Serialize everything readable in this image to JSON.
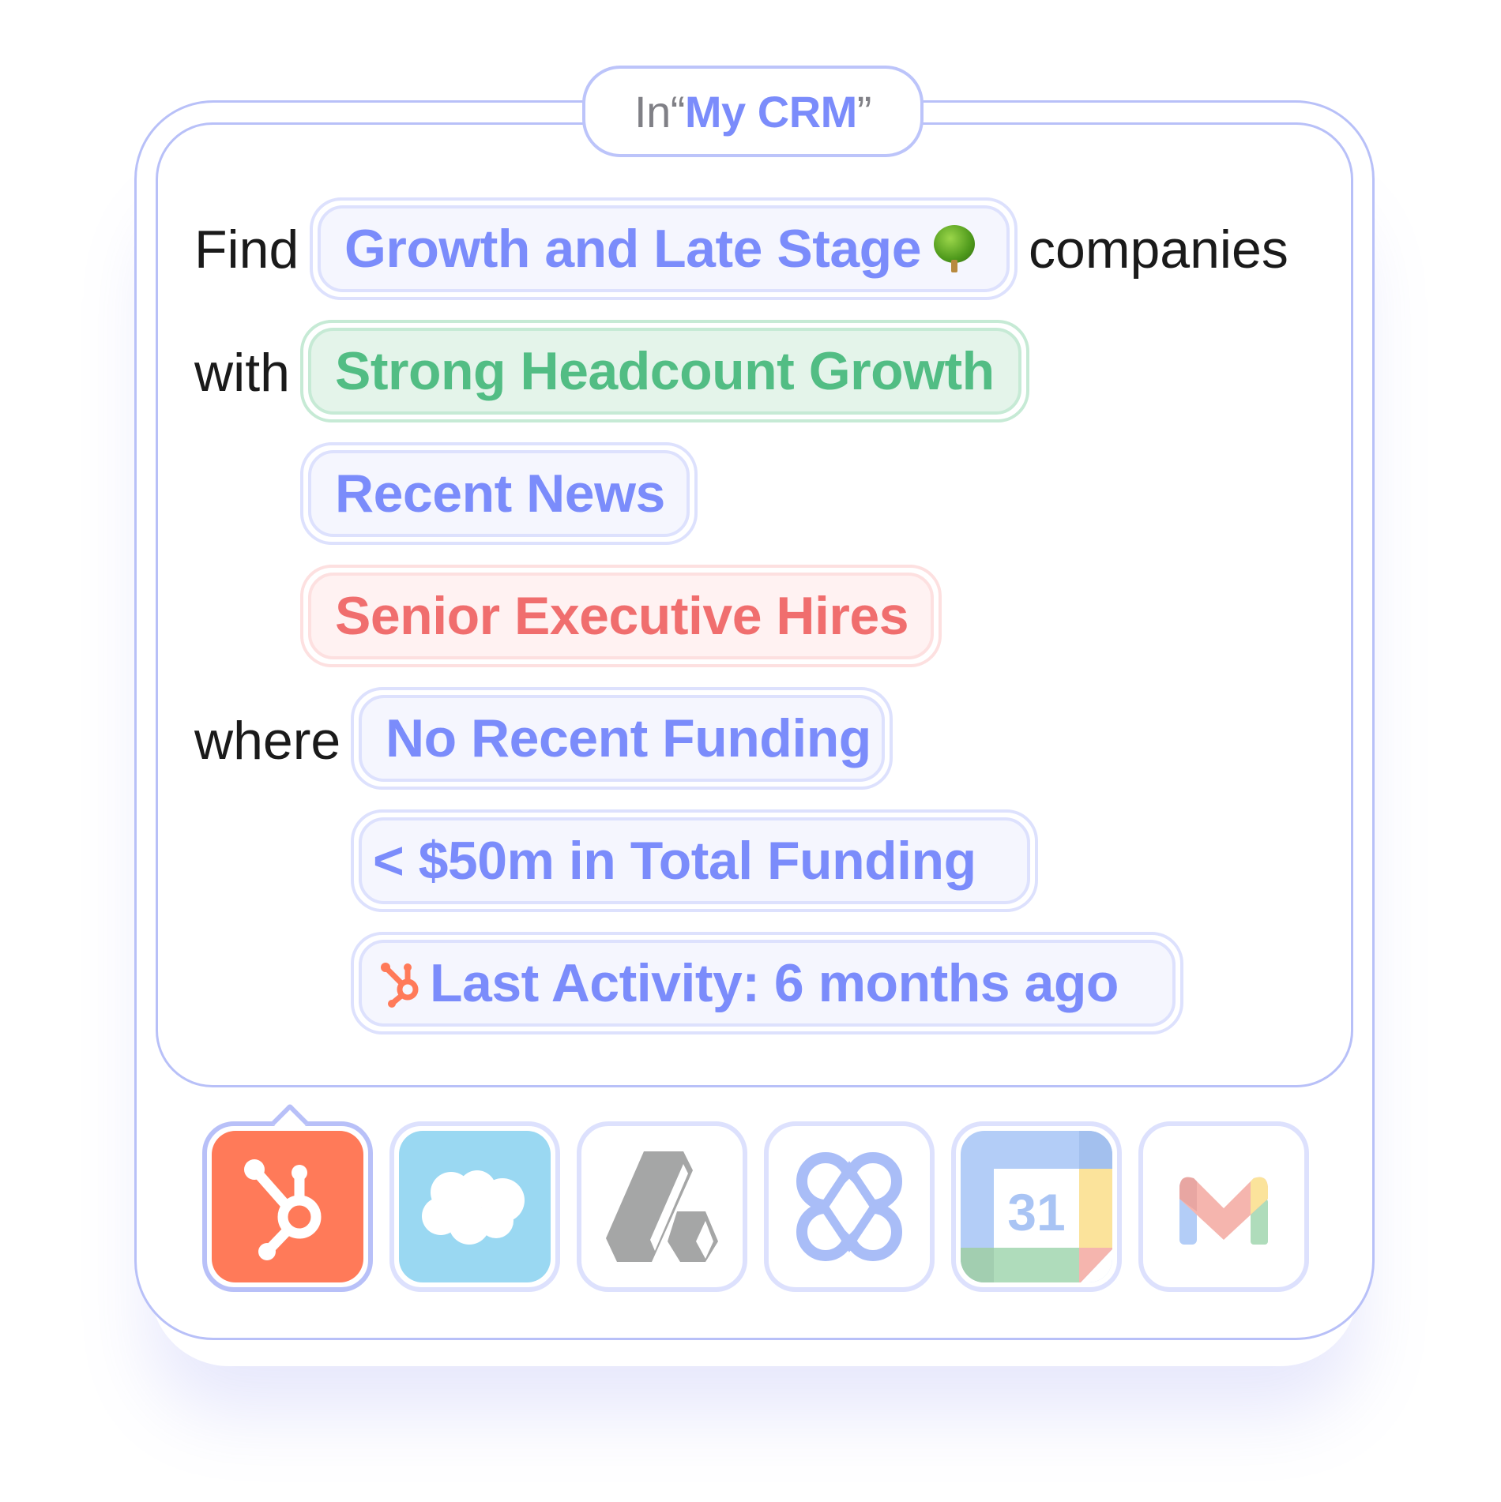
{
  "source": {
    "prefix": "In ",
    "open_quote": "“",
    "name": "My CRM",
    "close_quote": "”"
  },
  "query": {
    "find_label": "Find",
    "stage_filter": "Growth and Late Stage",
    "stage_emoji_icon": "deciduous-tree-icon",
    "companies_label": "companies",
    "with_label": "with",
    "signals": [
      {
        "label": "Strong Headcount Growth",
        "color": "#52bd84"
      },
      {
        "label": "Recent News",
        "color": "#7b8cfb"
      },
      {
        "label": "Senior Executive Hires",
        "color": "#f06e6e"
      }
    ],
    "where_label": "where",
    "conditions": [
      {
        "label": "No Recent Funding"
      },
      {
        "label": "< $50m in Total Funding"
      },
      {
        "label": "Last Activity: 6 months ago",
        "icon": "hubspot-icon"
      }
    ]
  },
  "integrations": [
    {
      "name": "HubSpot",
      "icon": "hubspot-icon",
      "active": true,
      "color": "#ff7a59"
    },
    {
      "name": "Salesforce",
      "icon": "salesforce-cloud-icon",
      "active": false,
      "color": "#9ad8f2"
    },
    {
      "name": "Attio",
      "icon": "attio-icon",
      "active": false,
      "color": "#a5a6a6"
    },
    {
      "name": "Affinity",
      "icon": "affinity-icon",
      "active": false,
      "color": "#a9bdf7"
    },
    {
      "name": "Google Calendar",
      "icon": "google-calendar-icon",
      "active": false,
      "calendar_day": "31"
    },
    {
      "name": "Gmail",
      "icon": "gmail-icon",
      "active": false
    }
  ],
  "colors": {
    "accent": "#7b8cfb",
    "border": "#b8c0f8",
    "text": "#1a1a1a",
    "muted": "#808086"
  }
}
